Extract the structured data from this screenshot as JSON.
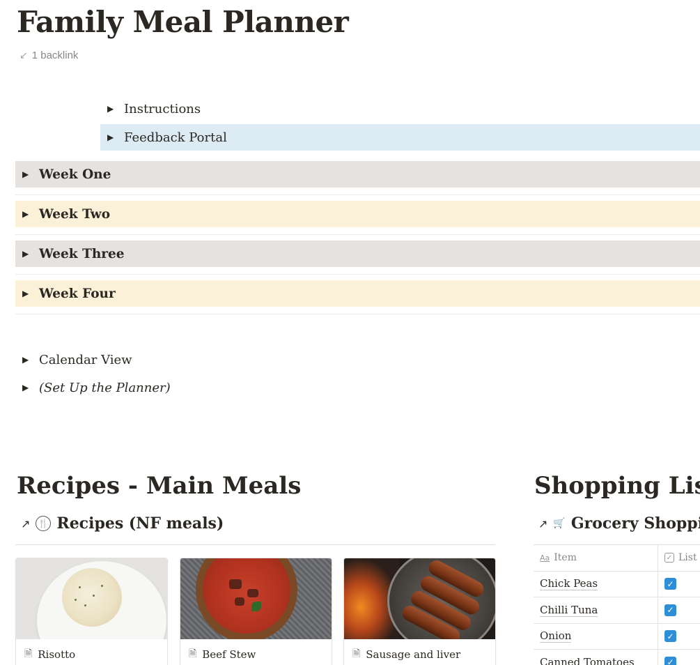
{
  "page": {
    "title": "Family Meal Planner",
    "backlink_text": "1 backlink"
  },
  "toggles": {
    "instructions": "Instructions",
    "feedback": "Feedback Portal",
    "week_one": "Week One",
    "week_two": "Week Two",
    "week_three": "Week Three",
    "week_four": "Week Four",
    "calendar": "Calendar View",
    "setup": "(Set Up the Planner)"
  },
  "recipes": {
    "heading": "Recipes - Main Meals",
    "db_title": "Recipes (NF meals)",
    "cards": [
      {
        "label": "Risotto"
      },
      {
        "label": "Beef Stew"
      },
      {
        "label": "Sausage and liver"
      }
    ]
  },
  "shopping": {
    "heading": "Shopping List",
    "db_title": "Grocery Shoppi",
    "columns": {
      "item": "Item",
      "list": "List",
      "item_icon": "Aa"
    },
    "rows": [
      {
        "item": "Chick Peas",
        "checked": true
      },
      {
        "item": "Chilli Tuna",
        "checked": true
      },
      {
        "item": "Onion",
        "checked": true
      },
      {
        "item": "Canned Tomatoes",
        "checked": true
      }
    ]
  },
  "colors": {
    "blue_toggle": "#ddebf4",
    "grey_toggle": "#e5e2e0",
    "cream_toggle": "#faf1d8",
    "checkbox": "#2e8fd8"
  },
  "icons": {
    "backlink": "arrow-down-left-icon",
    "toggle": "triangle-right-icon",
    "linked_db": "arrow-up-right-icon",
    "recipe_db": "fork-knife-icon",
    "grocery_db": "cart-icon",
    "page": "page-icon"
  }
}
